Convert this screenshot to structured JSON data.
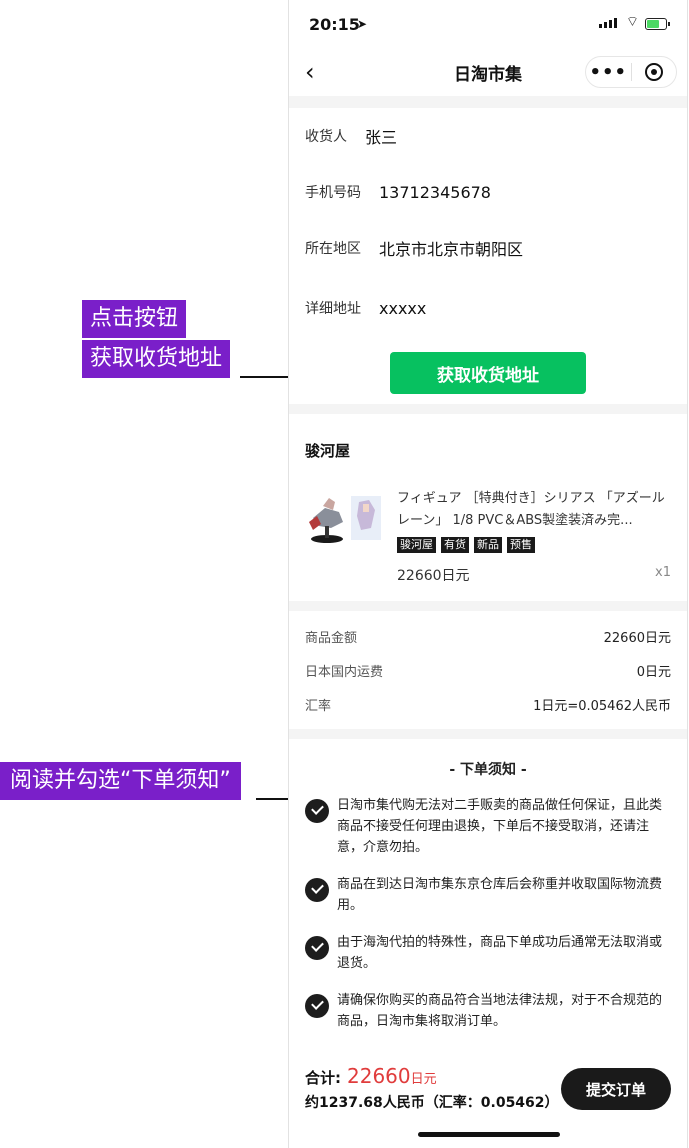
{
  "annotations": {
    "address_line1": "点击按钮",
    "address_line2": "获取收货地址",
    "notice": "阅读并勾选“下单须知”"
  },
  "status": {
    "time": "20:15",
    "location_icon": "location-arrow-icon",
    "battery_state": "charging"
  },
  "nav": {
    "title": "日淘市集",
    "more": "•••"
  },
  "address": {
    "receiver_label": "收货人",
    "receiver_value": "张三",
    "phone_label": "手机号码",
    "phone_value": "13712345678",
    "region_label": "所在地区",
    "region_value": "北京市北京市朝阳区",
    "detail_label": "详细地址",
    "detail_value": "xxxxx",
    "button": "获取收货地址"
  },
  "order": {
    "shop": "骏河屋",
    "product_title": "フィギュア ［特典付き］シリアス 「アズールレーン」 1/8 PVC＆ABS製塗装済み完...",
    "tags": [
      "骏河屋",
      "有货",
      "新品",
      "预售"
    ],
    "price": "22660日元",
    "qty": "x1"
  },
  "fees": [
    {
      "k": "商品金额",
      "v": "22660日元"
    },
    {
      "k": "日本国内运费",
      "v": "0日元"
    },
    {
      "k": "汇率",
      "v": "1日元=0.05462人民币"
    }
  ],
  "notice": {
    "title": "- 下单须知 -",
    "items": [
      "日淘市集代购无法对二手贩卖的商品做任何保证，且此类商品不接受任何理由退换，下单后不接受取消，还请注意，介意勿拍。",
      "商品在到达日淘市集东京仓库后会称重并收取国际物流费用。",
      "由于海淘代拍的特殊性，商品下单成功后通常无法取消或退货。",
      "请确保你购买的商品符合当地法律法规，对于不合规范的商品，日淘市集将取消订单。"
    ]
  },
  "footer": {
    "total_label": "合计:",
    "total_value": "22660",
    "total_unit": "日元",
    "approx": "约1237.68人民币（汇率：0.05462）",
    "submit": "提交订单"
  },
  "colors": {
    "accent_green": "#07c160",
    "price_red": "#e03c3c",
    "annotation_purple": "#7a1fc9"
  }
}
